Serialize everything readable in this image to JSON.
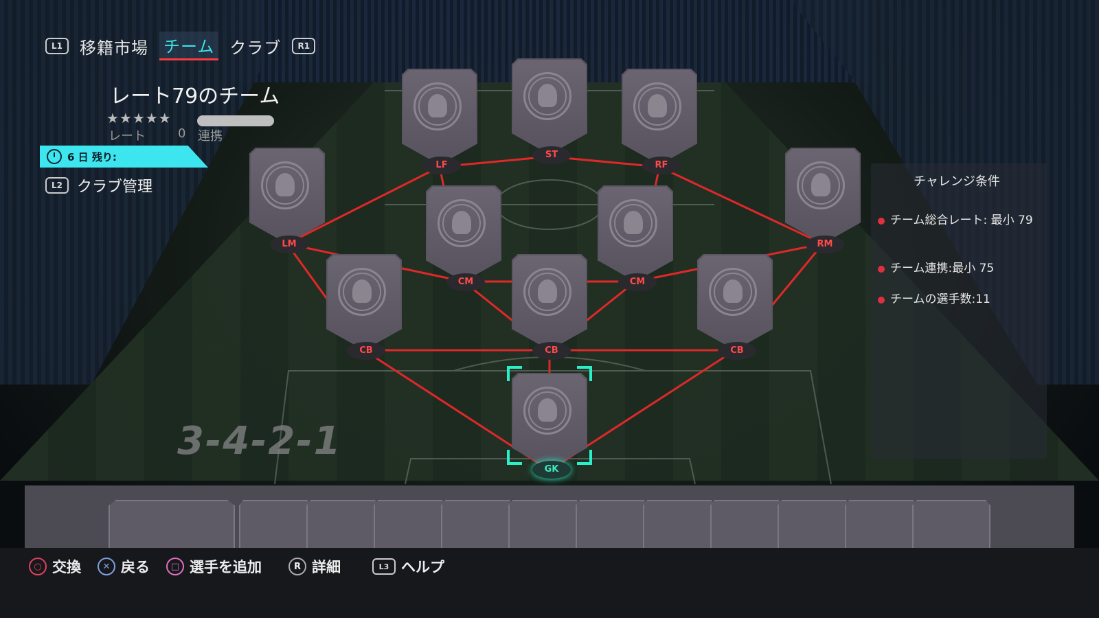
{
  "header": {
    "left_button": "L1",
    "right_button": "R1",
    "tabs": [
      {
        "label": "移籍市場",
        "active": false
      },
      {
        "label": "チーム",
        "active": true
      },
      {
        "label": "クラブ",
        "active": false
      }
    ]
  },
  "squad": {
    "title": "レート79のチーム",
    "stars": "★★★★★",
    "rating_label": "レート",
    "rating_value": "0",
    "chemistry_label": "連携",
    "timer": "6 日 残り:",
    "club_button": "L2",
    "club_label": "クラブ管理",
    "formation": "3-4-2-1"
  },
  "positions": [
    {
      "id": "lf",
      "label": "LF"
    },
    {
      "id": "st",
      "label": "ST"
    },
    {
      "id": "rf",
      "label": "RF"
    },
    {
      "id": "lm",
      "label": "LM"
    },
    {
      "id": "cm1",
      "label": "CM"
    },
    {
      "id": "cm2",
      "label": "CM"
    },
    {
      "id": "rm",
      "label": "RM"
    },
    {
      "id": "cb1",
      "label": "CB"
    },
    {
      "id": "cb2",
      "label": "CB"
    },
    {
      "id": "cb3",
      "label": "CB"
    },
    {
      "id": "gk",
      "label": "GK"
    }
  ],
  "challenge": {
    "title": "チャレンジ条件",
    "requirements": [
      "チーム総合レート: 最小 79",
      "チーム連携:最小 75",
      "チームの選手数:11"
    ]
  },
  "bottom_hints": [
    {
      "button": "○",
      "label": "交換"
    },
    {
      "button": "✕",
      "label": "戻る"
    },
    {
      "button": "□",
      "label": "選手を追加"
    },
    {
      "button": "R",
      "label": "詳細"
    },
    {
      "button": "L3",
      "label": "ヘルプ"
    }
  ],
  "colors": {
    "accent": "#3de6ef",
    "link_line": "#e02828",
    "position_text": "#ff4a4a",
    "selection": "#2af0c8"
  }
}
